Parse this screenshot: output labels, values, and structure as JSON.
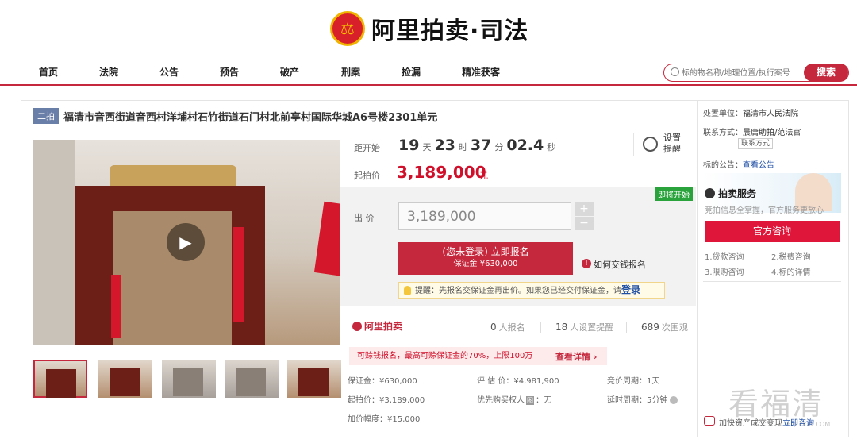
{
  "brand": {
    "logo_text": "阿里拍卖·司法",
    "emblem_icon": "scales-icon"
  },
  "nav": {
    "items": [
      "首页",
      "法院",
      "公告",
      "预告",
      "破产",
      "刑案",
      "捡漏",
      "精准获客"
    ]
  },
  "search": {
    "placeholder": "标的物名称/地理位置/执行案号",
    "button": "搜索"
  },
  "lot": {
    "round": "二拍",
    "title": "福清市音西街道音西村洋埔村石竹街道石门村北前亭村国际华城A6号楼2301单元"
  },
  "countdown": {
    "label": "距开始",
    "days": "19",
    "days_unit": "天",
    "hours": "23",
    "hours_unit": "时",
    "minutes": "37",
    "minutes_unit": "分",
    "seconds": "02.4",
    "seconds_unit": "秒",
    "remind_label": "设置提醒"
  },
  "start_price": {
    "label": "起拍价",
    "value": "3,189,000",
    "unit": "元"
  },
  "bid": {
    "status_tag": "即将开始",
    "label": "出 价",
    "value": "3,189,000",
    "plus": "+",
    "minus": "−",
    "signup_line1": "(您未登录) 立即报名",
    "signup_line2": "保证金 ¥630,000",
    "how_label": "如何交钱报名",
    "tip_text": "提醒：先报名交保证金再出价。如果您已经交付保证金，请",
    "tip_login": "登录"
  },
  "stats": {
    "brand": "阿里拍卖",
    "signups": "0",
    "signups_label": "人报名",
    "reminders": "18",
    "reminders_label": "人设置提醒",
    "views": "689",
    "views_label": "次围观"
  },
  "loan": {
    "text": "可赊钱报名，最高可赊保证金的70%，上限100万",
    "more": "查看详情 ›"
  },
  "details": {
    "deposit": "保证金：¥630,000",
    "appraisal": "评 估 价：¥4,981,900",
    "cycle": "竞价周期：1天",
    "start_price": "起拍价：¥3,189,000",
    "priority_label": "优先购买权人",
    "priority_tag": "图",
    "priority_value": "：无",
    "delay": "延时周期：5分钟",
    "increment": "加价幅度：¥15,000"
  },
  "right": {
    "court_label": "处置单位：",
    "court": "福清市人民法院",
    "contact_label": "联系方式：",
    "contact_name": "晨庸助拍/范法官",
    "contact_btn": "联系方式",
    "notice_label": "标的公告：",
    "notice_link": "查看公告",
    "service_title": "拍卖服务",
    "service_sub": "竞拍信息全掌握，官方服务更放心",
    "consult_btn": "官方咨询",
    "q1": "1.贷款咨询",
    "q2": "2.税费咨询",
    "q3": "3.限购咨询",
    "q4": "4.标的详情",
    "bottom_text": "加快资产成交变现",
    "bottom_link": "立即咨询",
    "watermark": "看福清",
    "watermark_sub": "FQLOOK.COM"
  },
  "colors": {
    "brand_red": "#c5283d",
    "price_red": "#d0102b",
    "link_blue": "#1f4fa5",
    "soon_green": "#2aa33c"
  }
}
